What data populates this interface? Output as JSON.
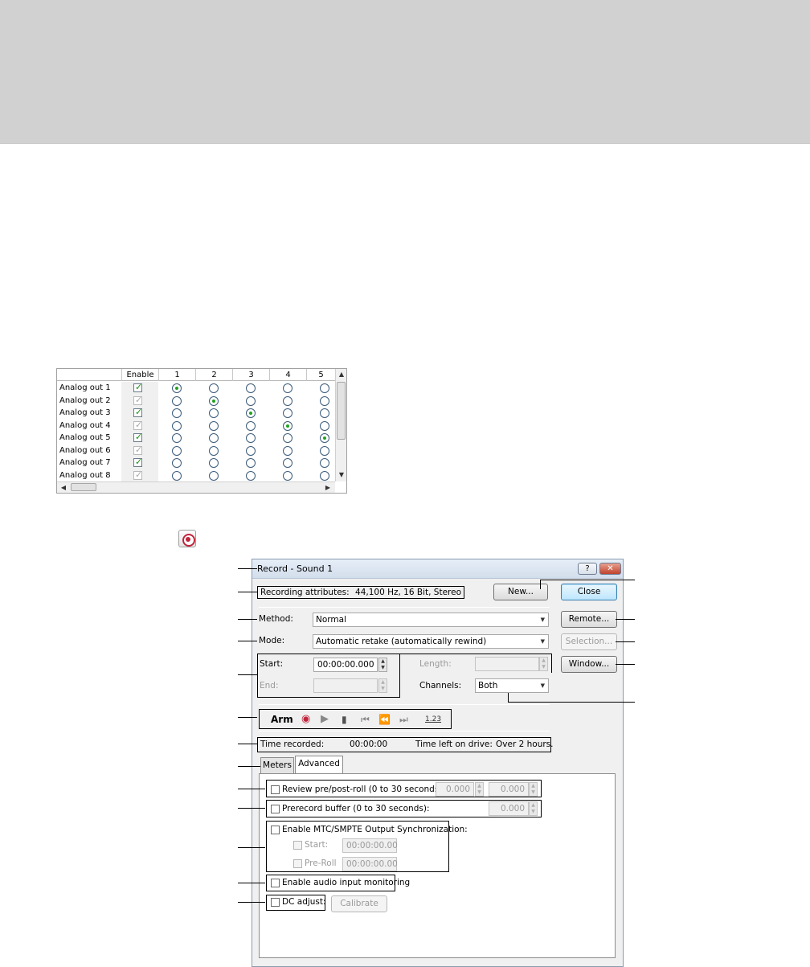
{
  "grid": {
    "columns": [
      "Enable",
      "1",
      "2",
      "3",
      "4",
      "5"
    ],
    "rows": [
      {
        "label": "Analog out 1",
        "enabled": true,
        "selected": 1
      },
      {
        "label": "Analog out 2",
        "enabled": false,
        "selected": 2
      },
      {
        "label": "Analog out 3",
        "enabled": true,
        "selected": 3
      },
      {
        "label": "Analog out 4",
        "enabled": false,
        "selected": 4
      },
      {
        "label": "Analog out 5",
        "enabled": true,
        "selected": 5
      },
      {
        "label": "Analog out 6",
        "enabled": false,
        "selected": 0
      },
      {
        "label": "Analog out 7",
        "enabled": true,
        "selected": 0
      },
      {
        "label": "Analog out 8",
        "enabled": false,
        "selected": 0
      }
    ]
  },
  "record_toolbar_icon": "record-icon",
  "dialog": {
    "title": "Record - Sound 1",
    "title_buttons": {
      "help": "?",
      "close": "✕"
    },
    "recording_attributes_label": "Recording attributes:",
    "recording_attributes_value": "44,100 Hz, 16 Bit, Stereo",
    "buttons": {
      "new": "New...",
      "close": "Close",
      "remote": "Remote...",
      "selection": "Selection...",
      "window": "Window..."
    },
    "method_label": "Method:",
    "method_value": "Normal",
    "mode_label": "Mode:",
    "mode_value": "Automatic retake (automatically rewind)",
    "start_label": "Start:",
    "start_value": "00:00:00.000",
    "end_label": "End:",
    "length_label": "Length:",
    "channels_label": "Channels:",
    "channels_value": "Both",
    "transport": {
      "arm": "Arm",
      "counter": "1.23"
    },
    "time_recorded_label": "Time recorded:",
    "time_recorded_value": "00:00:00",
    "time_left_label": "Time left on drive:",
    "time_left_value": "Over 2 hours.",
    "tabs": [
      "Meters",
      "Advanced"
    ],
    "active_tab": "Advanced",
    "advanced": {
      "review_label": "Review pre/post-roll (0 to 30 seconds):",
      "review_pre": "0.000",
      "review_post": "0.000",
      "prerecord_label": "Prerecord buffer (0 to 30 seconds):",
      "prerecord_value": "0.000",
      "mtc_label": "Enable MTC/SMPTE Output Synchronization:",
      "mtc_start_label": "Start:",
      "mtc_start_value": "00:00:00.00",
      "mtc_preroll_label": "Pre-Roll",
      "mtc_preroll_value": "00:00:00.00",
      "monitoring_label": "Enable audio input monitoring",
      "dc_adjust_label": "DC adjust:",
      "calibrate_label": "Calibrate"
    }
  }
}
